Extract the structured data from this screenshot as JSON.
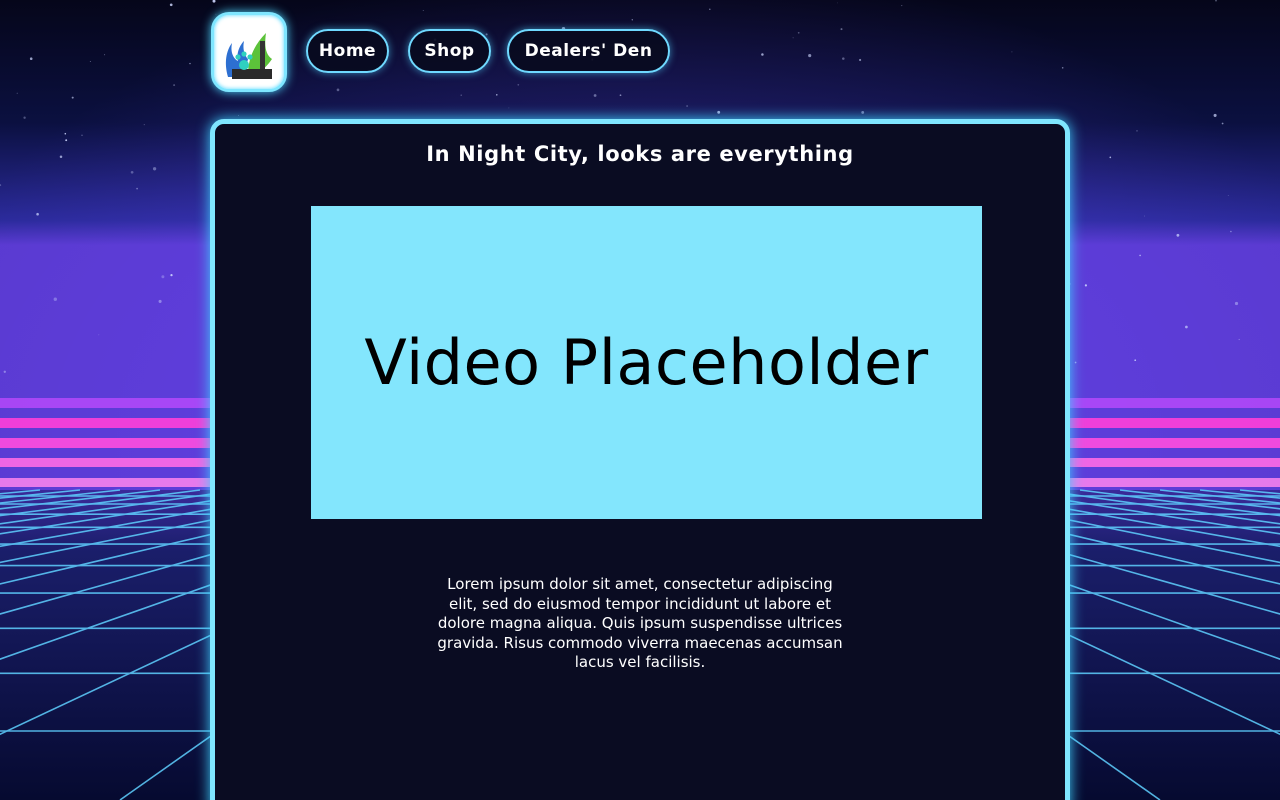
{
  "theme": {
    "accent": "#7fe6ff",
    "panel_background": "#0a0c22",
    "video_background": "#83e6fd",
    "neon_pink": "#ff3fd9"
  },
  "header": {
    "logo_icon": "paw-leaf-city-logo",
    "nav": [
      {
        "label": "Home"
      },
      {
        "label": "Shop"
      },
      {
        "label": "Dealers' Den"
      }
    ]
  },
  "main": {
    "title": "In Night City, looks are everything",
    "video": {
      "label": "Video Placeholder",
      "icon": "video-placeholder"
    },
    "body": "Lorem ipsum dolor sit amet, consectetur adipiscing elit, sed do eiusmod tempor incididunt ut labore et dolore magna aliqua. Quis ipsum suspendisse ultrices gravida. Risus commodo viverra maecenas accumsan lacus vel facilisis."
  }
}
